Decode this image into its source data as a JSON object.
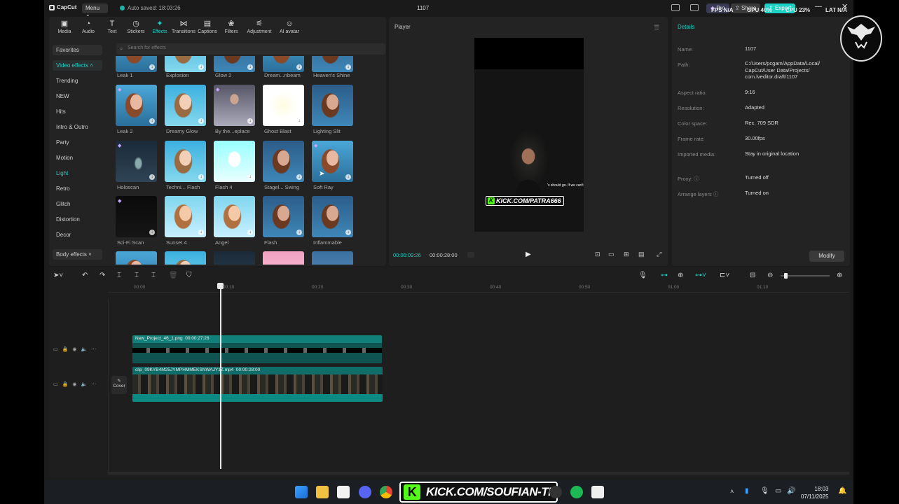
{
  "titlebar": {
    "app_name": "CapCut",
    "menu_label": "Menu",
    "autosave": "Auto saved: 18:03:26",
    "project_name": "1107",
    "pro_label": "Pro",
    "share_label": "Share",
    "export_label": "Export",
    "fps": "FPS N/A",
    "gpu": "GPU 40%",
    "cpu": "CPU 23%",
    "lat": "LAT N/A"
  },
  "toolbar_tabs": [
    {
      "label": "Media",
      "icon": "media-icon"
    },
    {
      "label": "Audio",
      "icon": "audio-icon"
    },
    {
      "label": "Text",
      "icon": "text-icon"
    },
    {
      "label": "Stickers",
      "icon": "stickers-icon"
    },
    {
      "label": "Effects",
      "icon": "effects-icon",
      "active": true
    },
    {
      "label": "Transitions",
      "icon": "transitions-icon"
    },
    {
      "label": "Captions",
      "icon": "captions-icon"
    },
    {
      "label": "Filters",
      "icon": "filters-icon"
    },
    {
      "label": "Adjustment",
      "icon": "adjustment-icon"
    },
    {
      "label": "AI avatar",
      "icon": "ai-avatar-icon"
    }
  ],
  "categories": {
    "favorites": "Favorites",
    "video_effects": "Video effects",
    "items": [
      "Trending",
      "NEW",
      "Hits",
      "Intro & Outro",
      "Party",
      "Motion",
      "Light",
      "Retro",
      "Glitch",
      "Distortion",
      "Decor"
    ],
    "selected": "Light",
    "body_effects": "Body effects"
  },
  "search": {
    "placeholder": "Search for effects"
  },
  "effects": {
    "row0": [
      "Leak 1",
      "Explosion",
      "Glow 2",
      "Dream...nbeam",
      "Heaven's Shine"
    ],
    "row1": [
      "Leak 2",
      "Dreamy Glow",
      "By the...eplace",
      "Ghost Blast",
      "Lighting Slit"
    ],
    "row2": [
      "Holoscan",
      "Techni... Flash",
      "Flash 4",
      "Stagel... Swing",
      "Soft Ray"
    ],
    "row3": [
      "Sci-Fi Scan",
      "Sunset 4",
      "Angel",
      "Flash",
      "Inflammable"
    ]
  },
  "player": {
    "title": "Player",
    "current_time": "00:00:09:26",
    "total_time": "00:00:28:00",
    "overlay_caption": "'s should go. If we can't",
    "overlay_link": "KICK.COM/PATRA666"
  },
  "details": {
    "title": "Details",
    "rows": [
      {
        "label": "Name:",
        "value": "1107"
      },
      {
        "label": "Path:",
        "value": "C:/Users/pcgam/AppData/Local/ CapCut/User Data/Projects/ com.lveditor.draft/1107"
      },
      {
        "label": "Aspect ratio:",
        "value": "9:16"
      },
      {
        "label": "Resolution:",
        "value": "Adapted"
      },
      {
        "label": "Color space:",
        "value": "Rec. 709 SDR"
      },
      {
        "label": "Frame rate:",
        "value": "30.00fps"
      },
      {
        "label": "Imported media:",
        "value": "Stay in original location"
      },
      {
        "label": "Proxy:",
        "value": "Turned off"
      },
      {
        "label": "Arrange layers",
        "value": "Turned on"
      }
    ],
    "modify_label": "Modify"
  },
  "timeline": {
    "ruler": [
      "00:00",
      "00:10",
      "00:20",
      "00:30",
      "00:40",
      "00:50",
      "01:00",
      "01:10"
    ],
    "clip1_name": "New_Project_46_1.png",
    "clip1_duration": "00:00:27:26",
    "clip2_name": "clip_09KYB4M25JYMPHMMEKSNWAJY1Z.mp4",
    "clip2_duration": "00:00:28:00",
    "cover_label": "Cover"
  },
  "taskbar": {
    "kick_banner": "KICK.COM/SOUFIAN-TI",
    "time": "18:03",
    "date": "07/11/2025"
  },
  "colors": {
    "accent": "#1ed1c5",
    "kick_green": "#53fc18",
    "clip_teal": "#12807a"
  }
}
